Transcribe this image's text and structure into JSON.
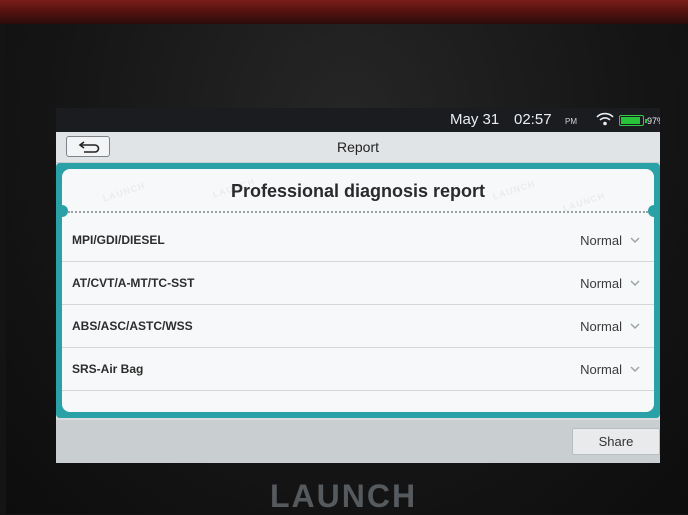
{
  "status_bar": {
    "date": "May 31",
    "time": "02:57",
    "ampm": "PM",
    "battery": "97%",
    "wifi_icon": "wifi-icon",
    "battery_icon": "battery-icon",
    "battery_color": "#27c43a"
  },
  "header": {
    "title": "Report",
    "back_icon": "back-arrow-icon"
  },
  "report": {
    "heading": "Professional diagnosis report",
    "watermark": "LAUNCH",
    "accent_color": "#2aa1a6",
    "rows": [
      {
        "label": "MPI/GDI/DIESEL",
        "value": "Normal"
      },
      {
        "label": "AT/CVT/A-MT/TC-SST",
        "value": "Normal"
      },
      {
        "label": "ABS/ASC/ASTC/WSS",
        "value": "Normal"
      },
      {
        "label": "SRS-Air Bag",
        "value": "Normal"
      }
    ]
  },
  "footer": {
    "share_label": "Share"
  },
  "device": {
    "brand": "LAUNCH"
  }
}
